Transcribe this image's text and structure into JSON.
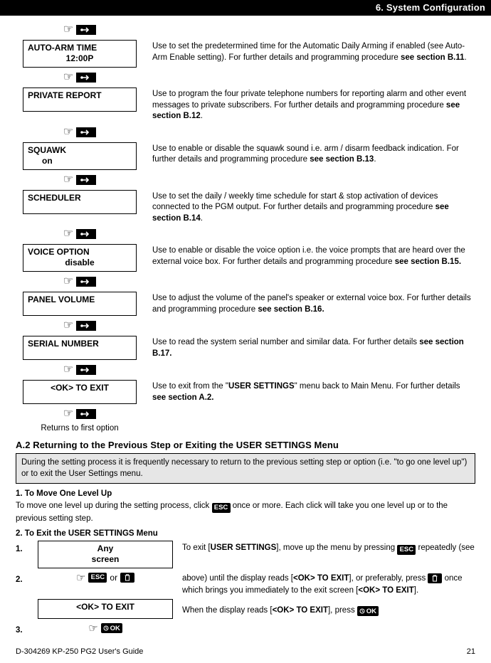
{
  "header": "6. System Configuration",
  "items": [
    {
      "screen": [
        "AUTO-ARM TIME",
        "12:00P"
      ],
      "center2": true,
      "desc_html": "Use to set the predetermined time for the Automatic Daily Arming if enabled (see Auto-Arm Enable setting). For further details and programming procedure <b>see section B.11</b>."
    },
    {
      "screen": [
        "PRIVATE REPORT"
      ],
      "desc_html": "Use to program the four private telephone numbers for reporting alarm and other event messages to private subscribers. For further details and programming procedure <b>see section B.12</b>."
    },
    {
      "screen": [
        "SQUAWK",
        "on"
      ],
      "indent2": true,
      "desc_html": "Use to enable or disable the squawk sound i.e. arm / disarm feedback indication. For further details and programming procedure <b>see section B.13</b>."
    },
    {
      "screen": [
        "SCHEDULER"
      ],
      "desc_html": "Use to set the daily / weekly time schedule for start & stop activation of devices connected to the PGM output. For further details and programming procedure <b>see section B.14</b>."
    },
    {
      "screen": [
        "VOICE OPTION",
        "disable"
      ],
      "center2": true,
      "desc_html": "Use to enable or disable the voice option i.e. the voice prompts that are heard over the external voice box. For further details and programming procedure <b>see section B.15.</b>"
    },
    {
      "screen": [
        "PANEL VOLUME"
      ],
      "desc_html": "Use to adjust the volume of the panel's speaker or external voice box. For further details and programming procedure <b>see section B.16.</b>"
    },
    {
      "screen": [
        "SERIAL NUMBER"
      ],
      "desc_html": "Use to read the system serial number and similar data. For further details <b>see section B.17.</b>"
    },
    {
      "screen": [
        "<OK> TO EXIT"
      ],
      "center": true,
      "desc_html": "Use to exit from the \"<b>USER SETTINGS</b>\" menu back to Main Menu. For further details <b>see section A.2.</b>"
    }
  ],
  "returns_note": "Returns to first option",
  "a2_title": "A.2 Returning to the Previous Step or Exiting the USER SETTINGS Menu",
  "a2_intro": "During the setting process it is frequently necessary to return to the previous setting step or option (i.e. \"to go one level up\") or to exit the User Settings menu.",
  "sub1": "1. To Move One Level Up",
  "sub1_text_pre": "To move one level up during the setting process, click ",
  "sub1_text_post": " once or more. Each click will take you one level up or to the previous setting step.",
  "sub2": "2. To Exit the USER SETTINGS Menu",
  "step1_screen": [
    "Any",
    "screen"
  ],
  "step_text_a": "To exit [",
  "step_text_a2": "USER SETTINGS",
  "step_text_a3": "], move up the menu by pressing ",
  "step_text_a4": " repeatedly (see",
  "step_text_b1": "above) until the display reads [",
  "step_text_b2": "<OK> TO EXIT",
  "step_text_b3": "], or preferably, press ",
  "step_text_b4": " once which brings you immediately to the exit screen [",
  "step_text_b5": "<OK> TO EXIT",
  "step_text_b6": "].",
  "step2_or": "or",
  "step_text_c1": "When the display reads [",
  "step_text_c2": "<OK> TO EXIT",
  "step_text_c3": "], press ",
  "ok_exit_screen": "<OK> TO EXIT",
  "footer_left": "D-304269 KP-250 PG2 User's Guide",
  "footer_right": "21",
  "esc_label": "ESC",
  "ok_label": "OK"
}
